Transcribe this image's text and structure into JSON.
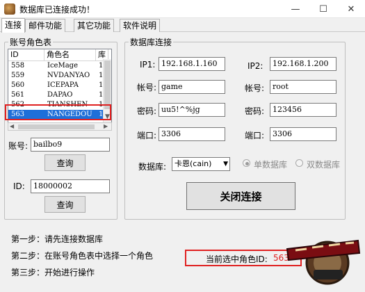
{
  "window": {
    "title": "数据库已连接成功！",
    "min_glyph": "—",
    "max_glyph": "☐",
    "close_glyph": "✕"
  },
  "tabs": [
    "连接",
    "邮件功能",
    "其它功能",
    "软件说明"
  ],
  "account_panel": {
    "title": "账号角色表",
    "columns": [
      "ID",
      "角色名",
      "库"
    ],
    "rows": [
      {
        "id": "558",
        "name": "IceMage",
        "db": "1"
      },
      {
        "id": "559",
        "name": "NVDANYAO",
        "db": "1"
      },
      {
        "id": "560",
        "name": "ICEPAPA",
        "db": "1"
      },
      {
        "id": "561",
        "name": "DAPAO",
        "db": "1"
      },
      {
        "id": "562",
        "name": "TIANSHEN",
        "db": "1"
      },
      {
        "id": "563",
        "name": "NANGEDOU",
        "db": "1"
      }
    ],
    "selected_index": 5,
    "account_label": "账号:",
    "account_value": "bailbo9",
    "query_label": "查询",
    "id_label": "ID:",
    "id_value": "18000002",
    "query2_label": "查询"
  },
  "db_panel": {
    "title": "数据库连接",
    "ip1_label": "IP1:",
    "ip1_value": "192.168.1.160",
    "ip2_label": "IP2:",
    "ip2_value": "192.168.1.200",
    "account1_label": "帐号:",
    "account1_value": "game",
    "account2_label": "帐号:",
    "account2_value": "root",
    "pwd1_label": "密码:",
    "pwd1_value": "uu5!^%jg",
    "pwd2_label": "密码:",
    "pwd2_value": "123456",
    "port1_label": "端口:",
    "port1_value": "3306",
    "port2_label": "端口:",
    "port2_value": "3306",
    "database_label": "数据库:",
    "database_value": "卡恩(cain)",
    "single_db_label": "单数据库",
    "dual_db_label": "双数据库",
    "close_button": "关闭连接"
  },
  "steps": {
    "step1": "第一步：请先连接数据库",
    "step2": "第二步：在账号角色表中选择一个角色",
    "step3": "第三步：开始进行操作"
  },
  "current_role": {
    "label": "当前选中角色ID:",
    "value": "563"
  },
  "colors": {
    "accent_red": "#e02020",
    "selection_blue": "#1e6fd9"
  }
}
